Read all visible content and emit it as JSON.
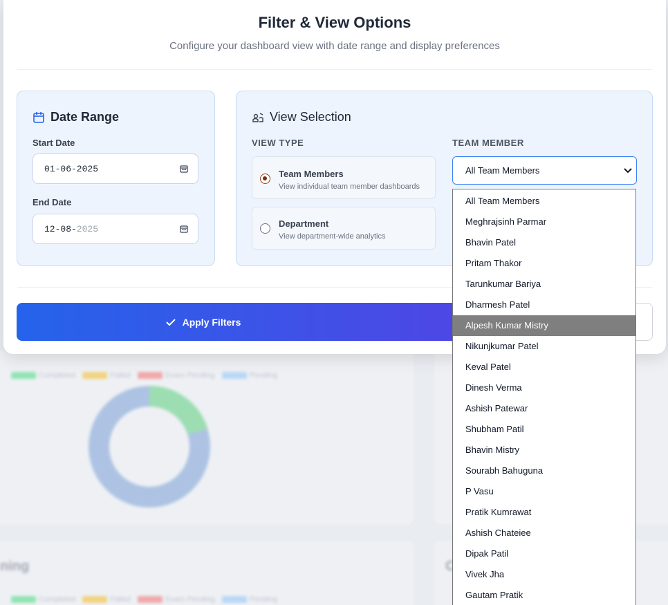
{
  "modal": {
    "title": "Filter & View Options",
    "subtitle": "Configure your dashboard view with date range and display preferences"
  },
  "date_range": {
    "title": "Date Range",
    "start_label": "Start Date",
    "start_value": "01-06-2025",
    "end_label": "End Date",
    "end_value_main": "12-08-",
    "end_value_muted": "2025"
  },
  "view_selection": {
    "title": "View Selection",
    "view_type_label": "VIEW TYPE",
    "team_member_label": "TEAM MEMBER",
    "options": [
      {
        "title": "Team Members",
        "desc": "View individual team member dashboards",
        "checked": true
      },
      {
        "title": "Department",
        "desc": "View department-wide analytics",
        "checked": false
      }
    ],
    "selected_member": "All Team Members"
  },
  "actions": {
    "apply_label": "Apply Filters"
  },
  "dropdown": {
    "highlighted": "Alpesh Kumar Mistry",
    "options": [
      "All Team Members",
      "Meghrajsinh Parmar",
      "Bhavin Patel",
      "Pritam Thakor",
      "Tarunkumar Bariya",
      "Dharmesh Patel",
      "Alpesh Kumar Mistry",
      "Nikunjkumar Patel",
      "Keval Patel",
      "Dinesh Verma",
      "Ashish Patewar",
      "Shubham Patil",
      "Bhavin Mistry",
      "Sourabh Bahuguna",
      "P Vasu",
      "Pratik Kumrawat",
      "Ashish Chateiee",
      "Dipak Patil",
      "Vivek Jha",
      "Gautam Pratik"
    ]
  },
  "background": {
    "legend": [
      "Completed",
      "Failed",
      "Exam Pending",
      "Pending"
    ],
    "legend_colors": [
      "#4ade80",
      "#fbbf24",
      "#f87171",
      "#93c5fd"
    ],
    "heading_fragment": "ning",
    "heading_fragment_2": "C"
  }
}
